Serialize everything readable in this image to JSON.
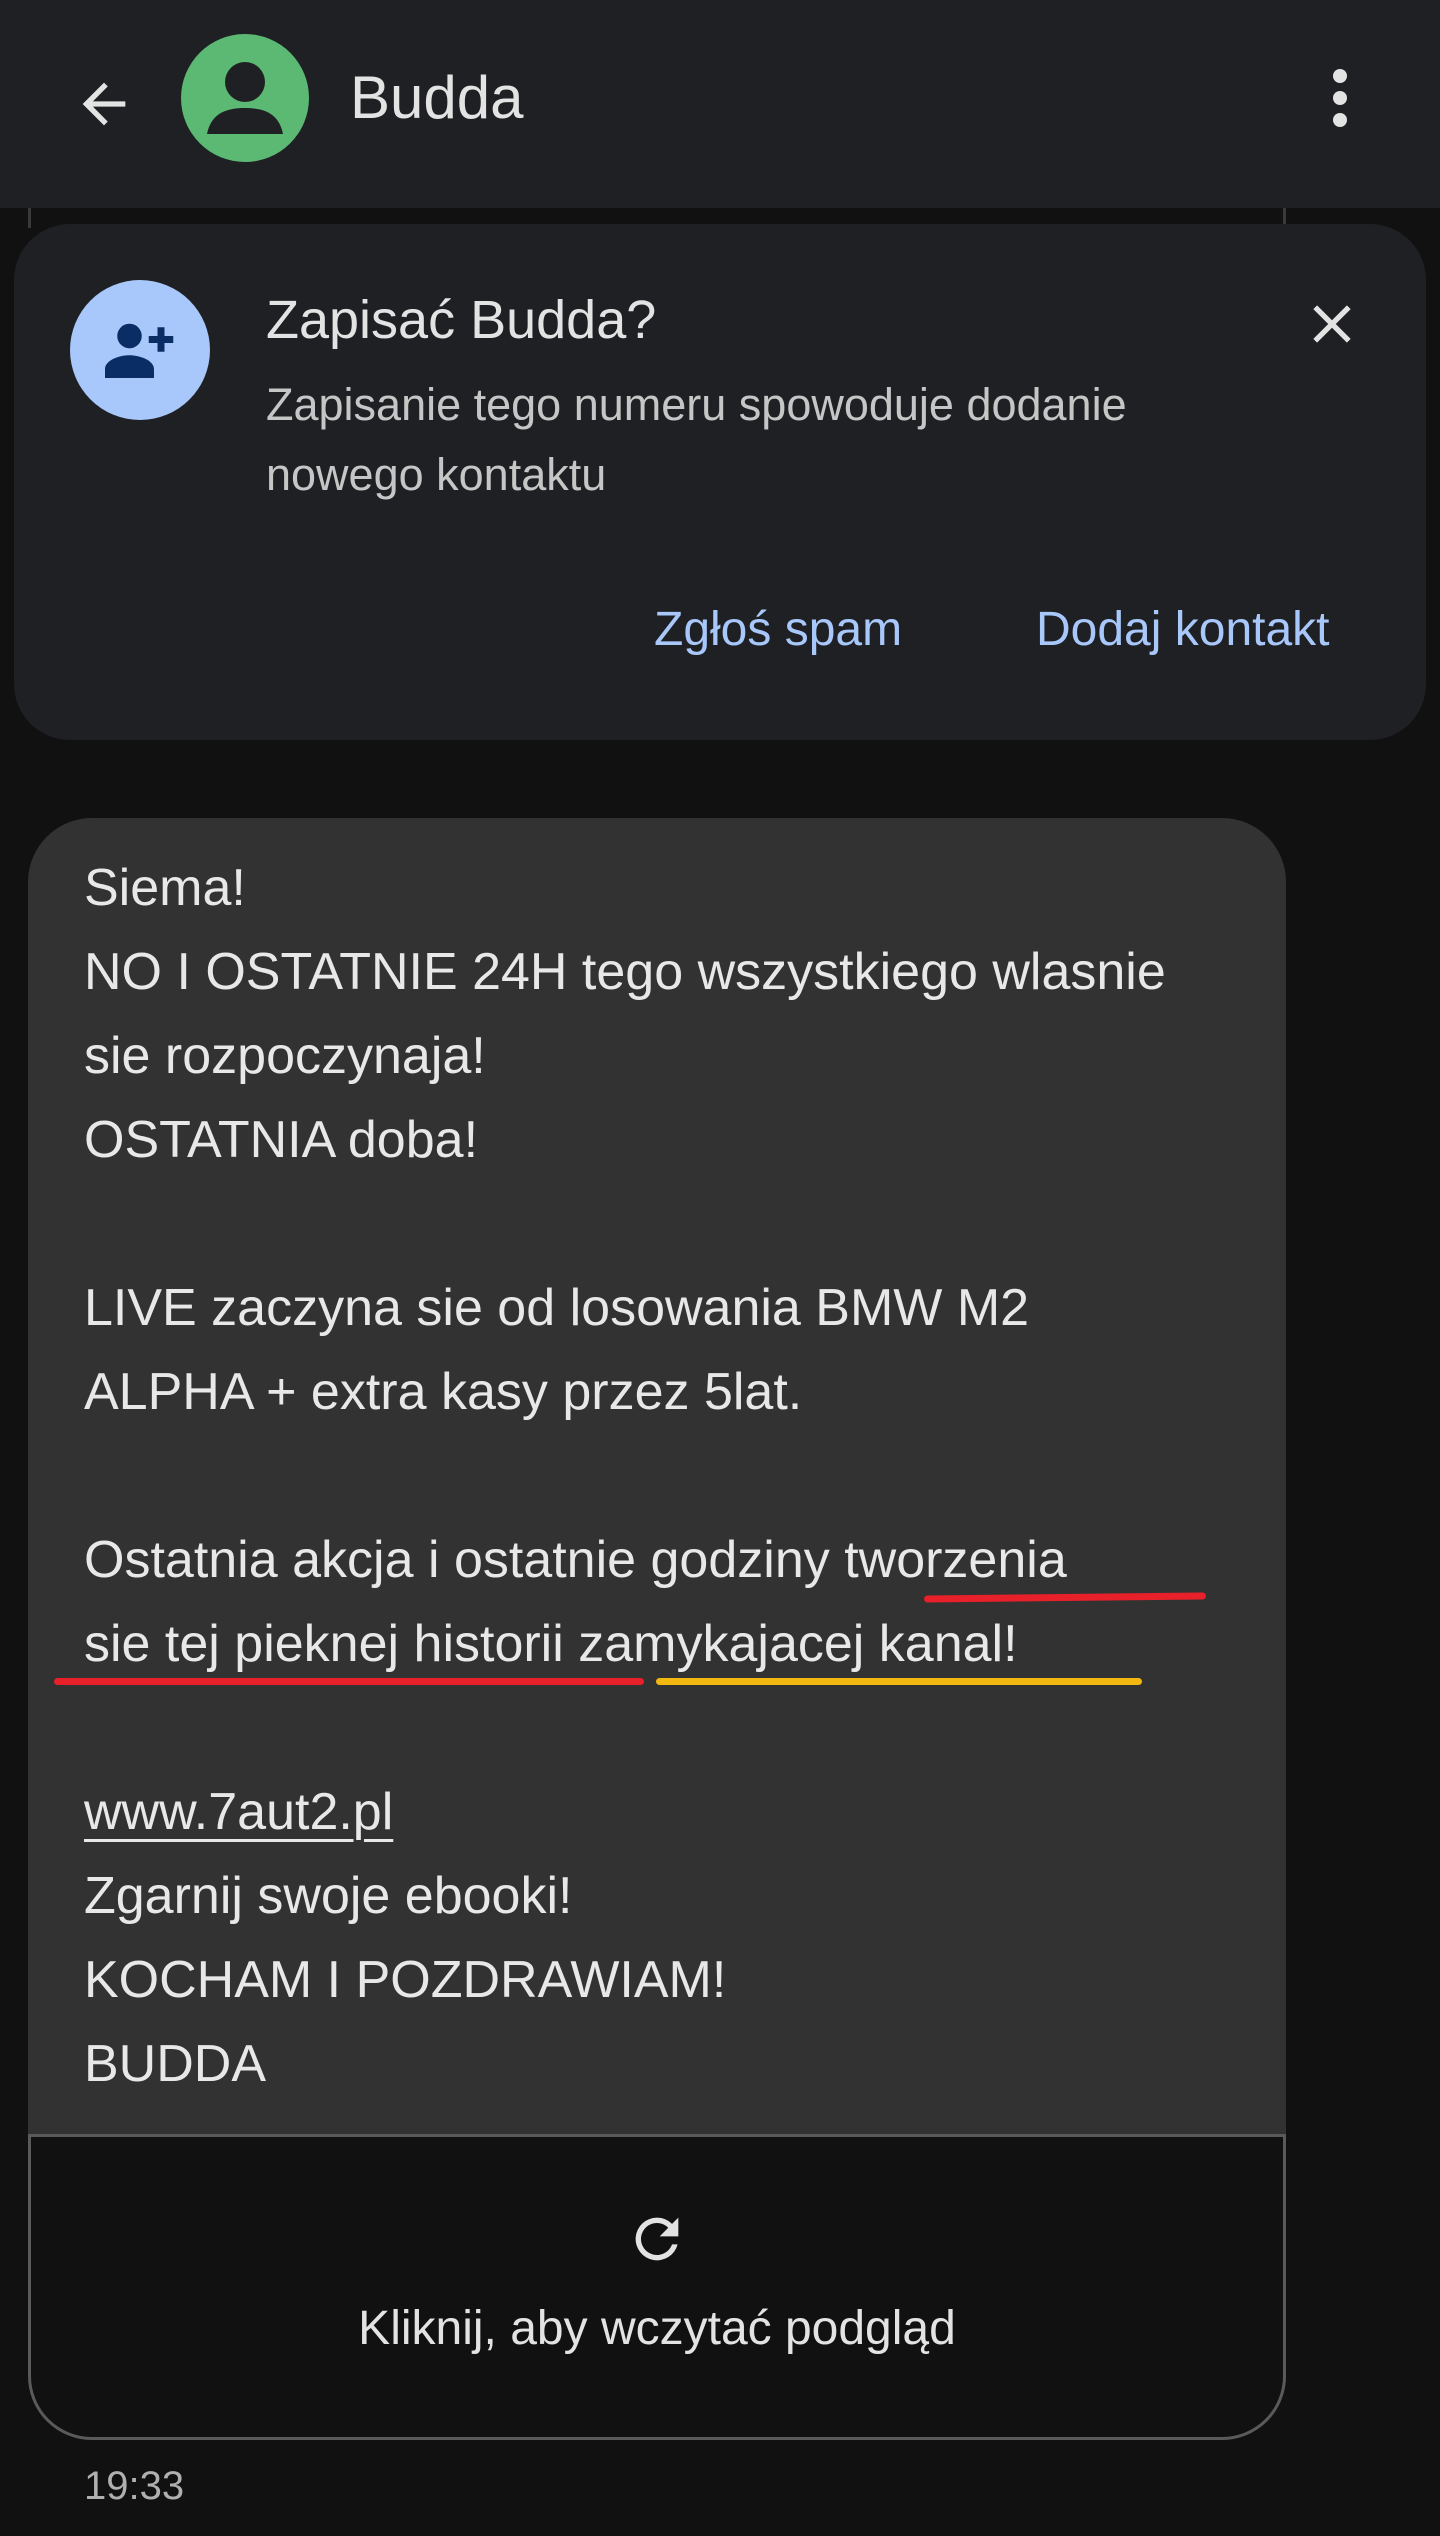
{
  "app_bar": {
    "contact_name": "Budda",
    "avatar_color": "#5bb974",
    "icons": [
      "arrow-left-icon",
      "person-icon",
      "more-vert-icon"
    ]
  },
  "save_card": {
    "title": "Zapisać Budda?",
    "body": "Zapisanie tego numeru spowoduje dodanie nowego kontaktu",
    "report_spam": "Zgłoś spam",
    "add_contact": "Dodaj kontakt",
    "accent": "#a8c7fa",
    "icons": [
      "person-add-icon",
      "close-icon"
    ]
  },
  "hidden_time_peek": "19:33",
  "message": {
    "lines": [
      "Siema!",
      "NO I OSTATNIE 24H tego wszystkiego wlasnie",
      "sie rozpoczynaja!",
      "OSTATNIA doba!",
      "LIVE zaczyna sie od losowania BMW M2",
      "ALPHA + extra kasy przez 5lat.",
      "Ostatnia akcja i ostatnie godziny tworzenia",
      "sie tej pieknej historii zamykajacej kanal!",
      "www.7aut2.pl",
      "Zgarnij swoje ebooki!",
      "KOCHAM I POZDRAWIAM!",
      "BUDDA"
    ],
    "link": "www.7aut2.pl",
    "annotation_colors": {
      "red": "#e8202a",
      "yellow": "#f3b80f"
    }
  },
  "preview": {
    "label": "Kliknij, aby wczytać podgląd",
    "icon": "refresh-icon"
  },
  "timestamp": "19:33"
}
